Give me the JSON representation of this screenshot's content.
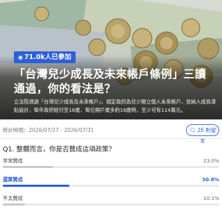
{
  "post": {
    "views_badge": "71.0k人已參加",
    "title": "「台灣兒少成長及未來帳戶條例」三讀通過，你的看法是？",
    "description": "立法院通過「台灣兒少成長及未來帳戶」，規定政府為兒少開立個人未來帳戶，並納入成長津貼設計，每年政府給付至18歲，每位開戶最多約18歲時，至少可有114萬元。"
  },
  "meta": {
    "date_range": "統計時間：2026/07/27 - 2026/07/31",
    "comments_label": "25 則留言"
  },
  "poll": {
    "question": "Q1. 整體而言，你是否贊成這項政策？",
    "options": [
      {
        "label": "非常贊成",
        "percent_text": "23.0%",
        "value": 23.0,
        "selected": false
      },
      {
        "label": "還算贊成",
        "percent_text": "30.8%",
        "value": 30.8,
        "selected": true
      },
      {
        "label": "不太贊成",
        "percent_text": "10.1%",
        "value": 10.1,
        "selected": false
      }
    ]
  },
  "colors": {
    "accent": "#2d5fd9"
  }
}
